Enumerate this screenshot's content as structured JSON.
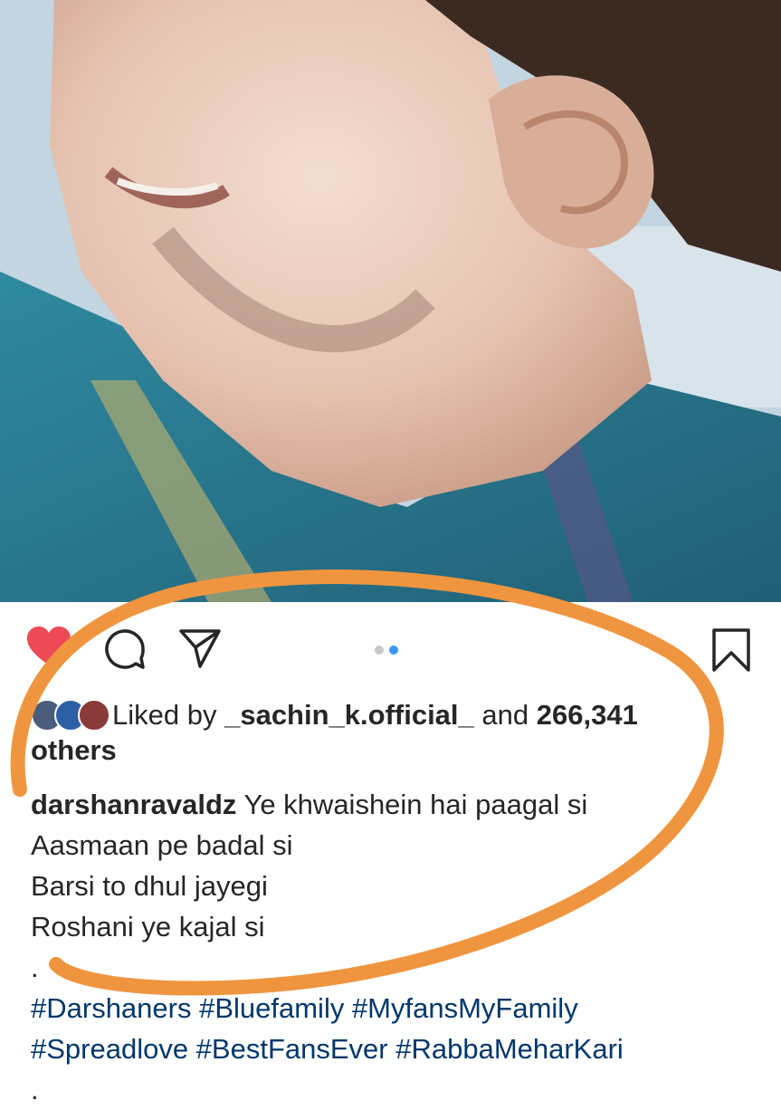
{
  "post": {
    "photo_alt": "",
    "liked_by_prefix": "Liked by",
    "liked_by_user": "_sachin_k.official_",
    "liked_by_and": "and",
    "likes_count": "266,341",
    "others": "others",
    "caption_user": "darshanravaldz",
    "caption_lines": [
      "Ye khwaishein hai paagal si",
      "Aasmaan pe badal si",
      "Barsi to dhul jayegi",
      "Roshani ye kajal si",
      "."
    ],
    "hashtags_line1": "#Darshaners #Bluefamily #MyfansMyFamily",
    "hashtags_line2": "#Spreadlove #BestFansEver #RabbaMeharKari",
    "trailing_dot": ".",
    "carousel_total": 2,
    "carousel_active": 2
  },
  "colors": {
    "heart": "#ed4956",
    "link": "#00376b",
    "dot_active": "#3897f0",
    "dot_inactive": "#c7c7c7",
    "annotation": "#f0953f"
  },
  "icons": {
    "like": "heart-filled-icon",
    "comment": "comment-bubble-icon",
    "share": "paper-plane-icon",
    "save": "bookmark-icon"
  }
}
